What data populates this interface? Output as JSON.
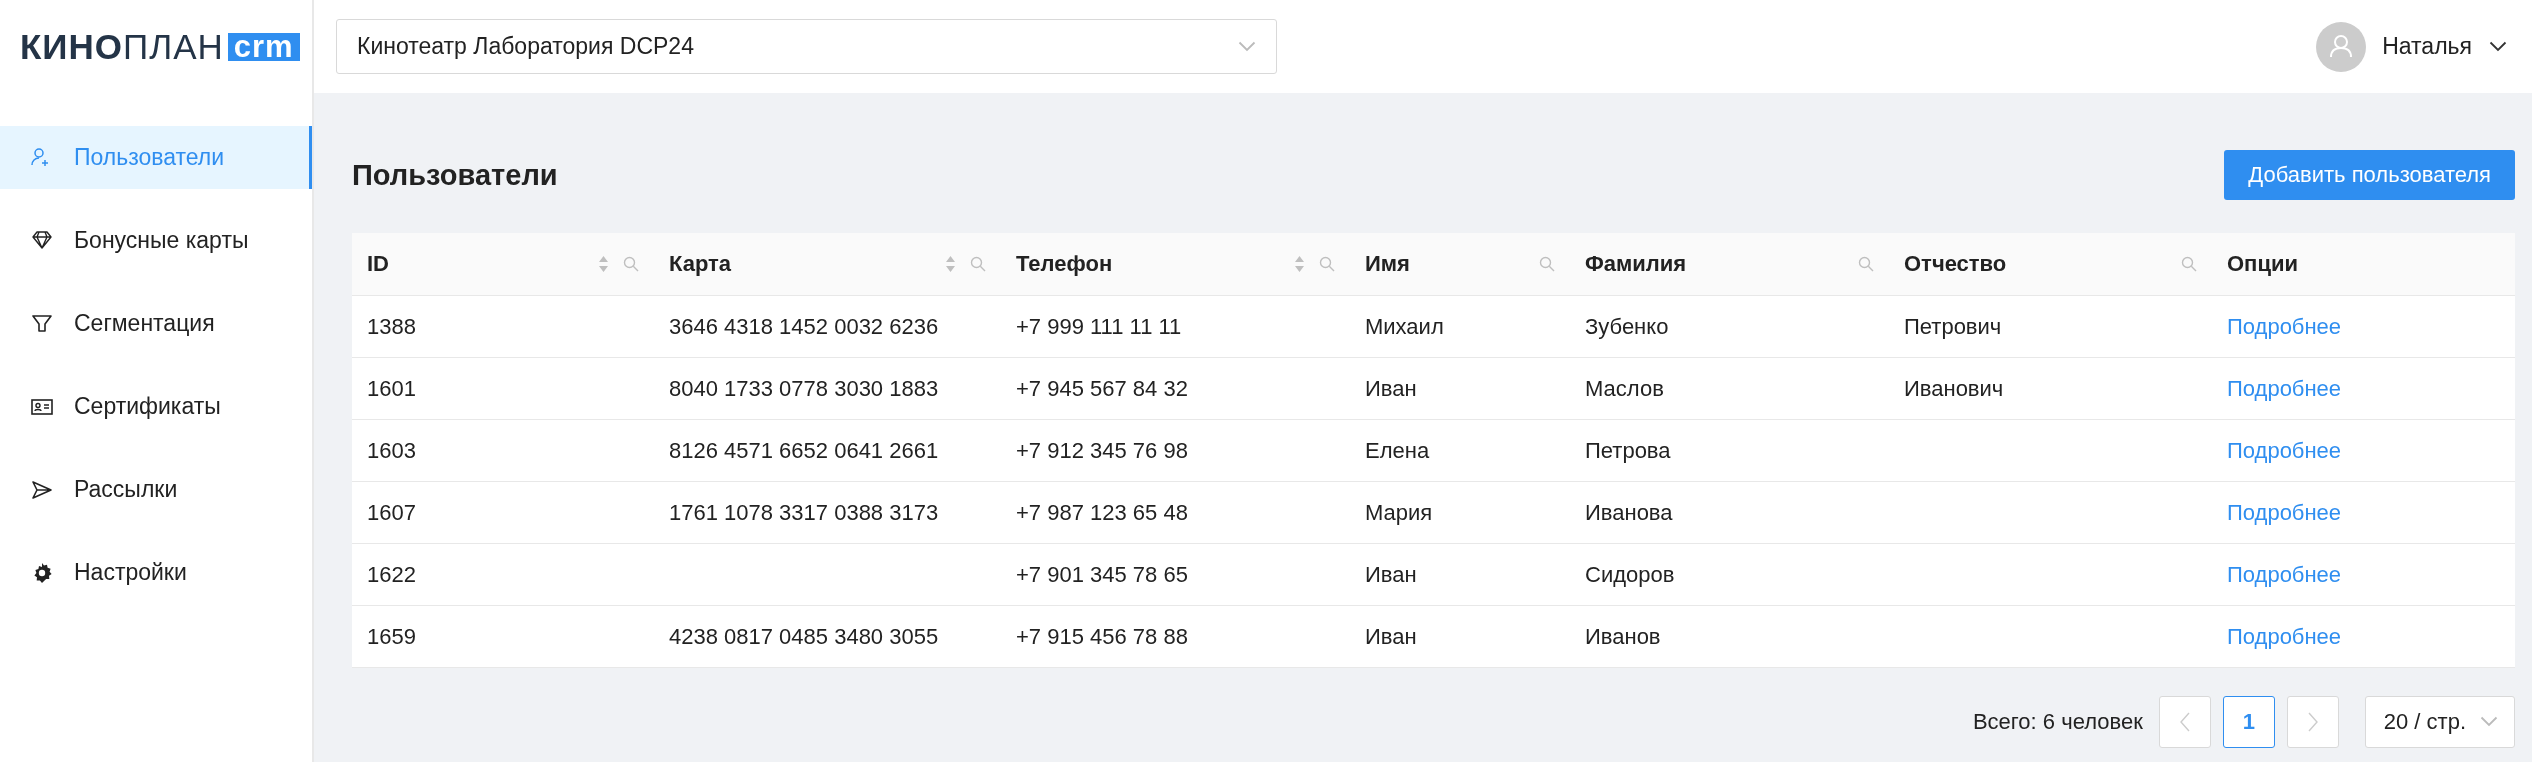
{
  "logo": {
    "primary": "КИНО",
    "secondary": "ПЛАН",
    "badge": "crm"
  },
  "sidebar": {
    "items": [
      {
        "label": "Пользователи",
        "selected": true
      },
      {
        "label": "Бонусные карты",
        "selected": false
      },
      {
        "label": "Сегментация",
        "selected": false
      },
      {
        "label": "Сертификаты",
        "selected": false
      },
      {
        "label": "Рассылки",
        "selected": false
      },
      {
        "label": "Настройки",
        "selected": false
      }
    ]
  },
  "header": {
    "cinema_select": {
      "value": "Кинотеатр Лаборатория DCP24"
    },
    "user": {
      "name": "Наталья"
    }
  },
  "page": {
    "title": "Пользователи",
    "add_button": "Добавить пользователя"
  },
  "table": {
    "columns": [
      {
        "label": "ID",
        "sortable": true,
        "searchable": true
      },
      {
        "label": "Карта",
        "sortable": true,
        "searchable": true
      },
      {
        "label": "Телефон",
        "sortable": true,
        "searchable": true
      },
      {
        "label": "Имя",
        "sortable": false,
        "searchable": true
      },
      {
        "label": "Фамилия",
        "sortable": false,
        "searchable": true
      },
      {
        "label": "Отчество",
        "sortable": false,
        "searchable": true
      },
      {
        "label": "Опции",
        "sortable": false,
        "searchable": false
      }
    ],
    "rows": [
      {
        "cells": [
          "1388",
          "3646 4318 1452 0032 6236",
          "+7 999 111 11 11",
          "Михаил",
          "Зубенко",
          "Петрович"
        ],
        "link": "Подробнее"
      },
      {
        "cells": [
          "1601",
          "8040 1733 0778 3030 1883",
          "+7 945 567 84 32",
          "Иван",
          "Маслов",
          "Иванович"
        ],
        "link": "Подробнее"
      },
      {
        "cells": [
          "1603",
          "8126 4571 6652 0641 2661",
          "+7 912 345 76 98",
          "Елена",
          "Петрова",
          null
        ],
        "link": "Подробнее"
      },
      {
        "cells": [
          "1607",
          "1761 1078 3317 0388 3173",
          "+7 987 123 65 48",
          "Мария",
          "Иванова",
          null
        ],
        "link": "Подробнее"
      },
      {
        "cells": [
          "1622",
          null,
          "+7 901 345 78 65",
          "Иван",
          "Сидоров",
          null
        ],
        "link": "Подробнее"
      },
      {
        "cells": [
          "1659",
          "4238 0817 0485 3480 3055",
          "+7 915 456 78 88",
          "Иван",
          "Иванов",
          null
        ],
        "link": "Подробнее"
      }
    ]
  },
  "pagination": {
    "total": "Всего: 6 человек",
    "prev_disabled": true,
    "next_disabled": true,
    "pages": [
      {
        "label": "1",
        "selected": true
      }
    ],
    "page_size": "20 / стр."
  }
}
